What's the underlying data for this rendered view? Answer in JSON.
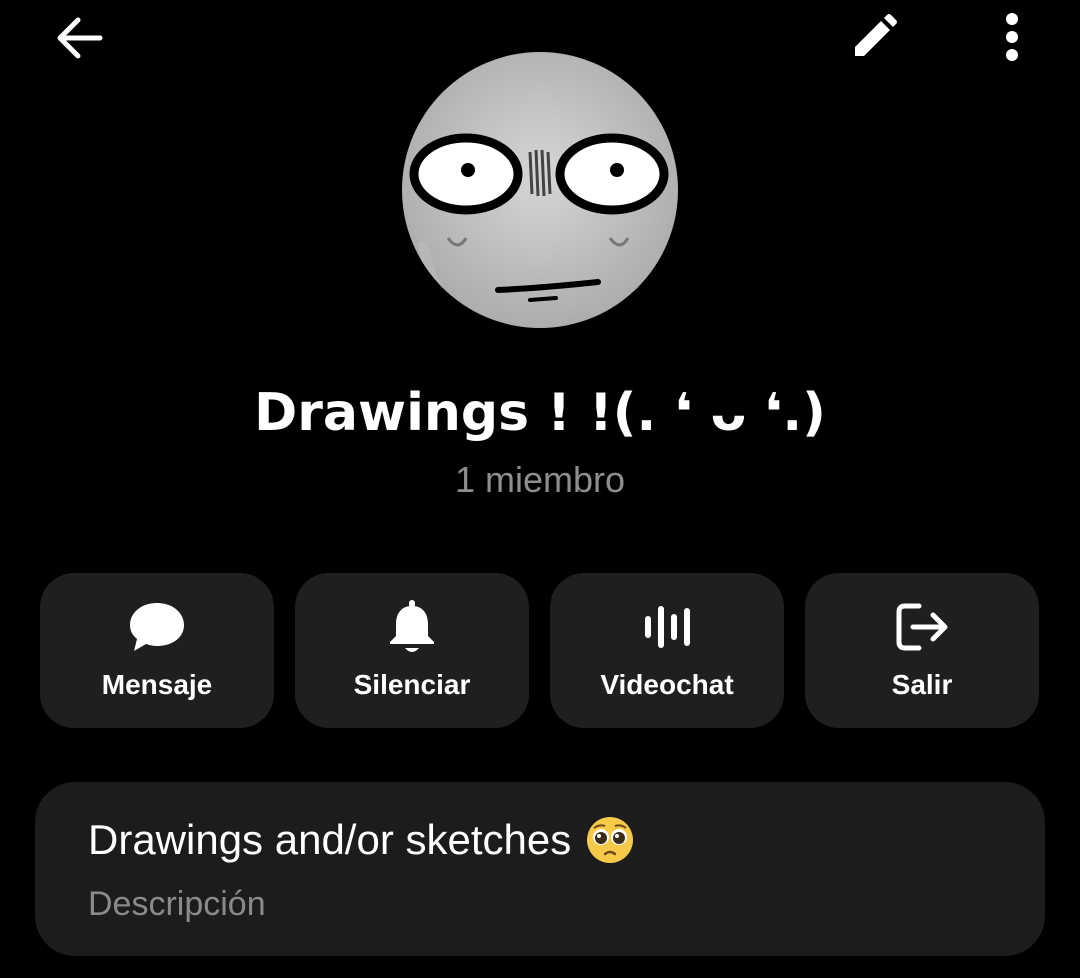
{
  "header": {
    "back_icon": "arrow-left-icon",
    "edit_icon": "pencil-icon",
    "more_icon": "more-vertical-icon"
  },
  "profile": {
    "avatar": "group-avatar",
    "title": "Drawings ! !(. ❛ ᴗ ❛.)",
    "members": "1 miembro"
  },
  "actions": [
    {
      "label": "Mensaje",
      "icon": "chat-bubble-icon"
    },
    {
      "label": "Silenciar",
      "icon": "bell-icon"
    },
    {
      "label": "Videochat",
      "icon": "voice-wave-icon"
    },
    {
      "label": "Salir",
      "icon": "exit-icon"
    }
  ],
  "description": {
    "text": "Drawings and/or sketches",
    "emoji": "pleading-face-emoji",
    "label": "Descripción"
  },
  "colors": {
    "background": "#000000",
    "card": "#1f1f1f",
    "muted_text": "#8e8e8e"
  }
}
